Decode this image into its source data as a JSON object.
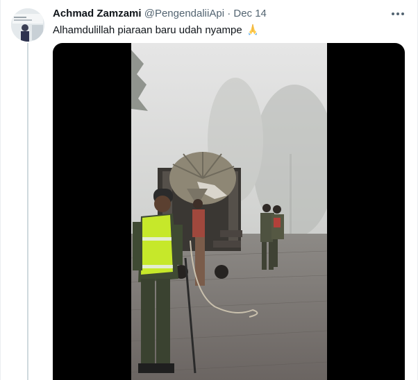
{
  "tweet": {
    "author_name": "Achmad Zamzami",
    "handle": "@PengendaliiApi",
    "separator": "·",
    "date": "Dec 14",
    "text": "Alhamdulillah piaraan baru udah nyampe",
    "emoji": "folded-hands-icon",
    "more_icon": "more-dots-icon"
  },
  "media": {
    "type": "video",
    "time_badge": "",
    "description_icon": "video-player"
  },
  "colors": {
    "name": "#0f1419",
    "secondary": "#536471",
    "thread_line": "#cfd9de",
    "media_bg": "#000000",
    "vest": "#c6e82a"
  }
}
